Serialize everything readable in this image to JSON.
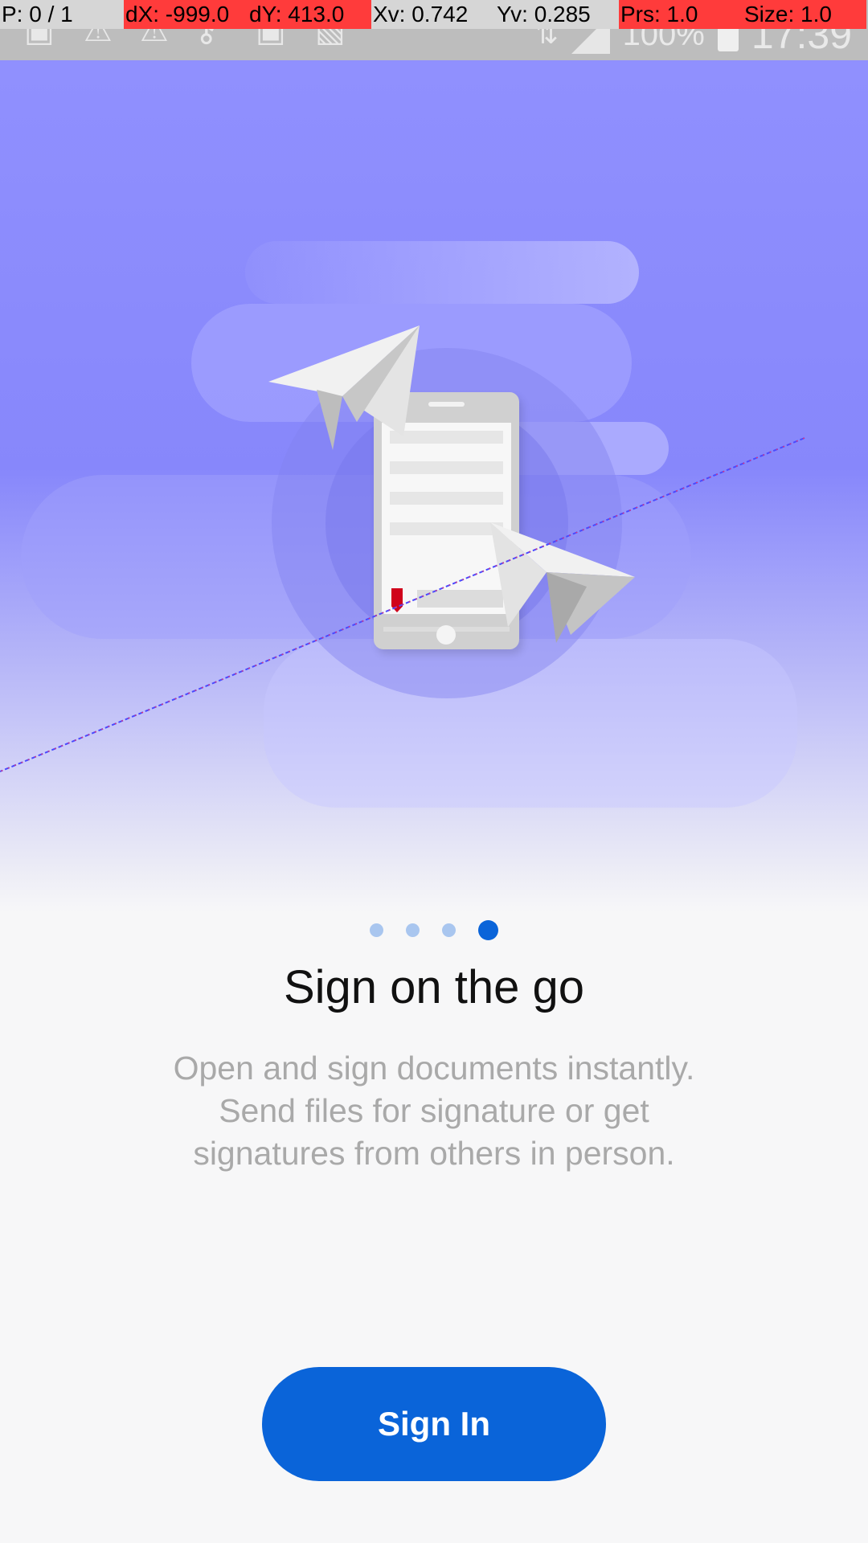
{
  "debug": {
    "pointer": "P: 0 / 1",
    "dx": "dX: -999.0",
    "dy": "dY: 413.0",
    "xv": "Xv: 0.742",
    "yv": "Yv: 0.285",
    "prs": "Prs: 1.0",
    "size": "Size: 1.0"
  },
  "status_bar": {
    "battery": "100%",
    "clock": "17:39",
    "icons": [
      "gallery-icon",
      "warning-icon",
      "warning-icon",
      "key-icon",
      "gallery-icon",
      "no-sim-icon",
      "data-arrows-icon",
      "signal-icon",
      "battery-icon"
    ]
  },
  "onboarding": {
    "pages_total": 4,
    "active_page": 4,
    "title": "Sign on the go",
    "description": "Open and sign documents instantly. Send files for signature or get signatures from others in person.",
    "button_label": "Sign In"
  },
  "colors": {
    "accent": "#0a64d9",
    "hero_top": "#9090fe",
    "dot_inactive": "#a9c6ef",
    "bookmark": "#d0021b"
  }
}
